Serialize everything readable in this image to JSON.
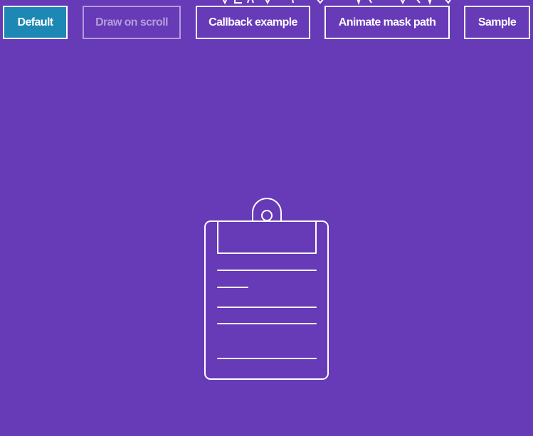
{
  "nav": {
    "buttons": [
      {
        "label": "Default",
        "state": "active"
      },
      {
        "label": "Draw on scroll",
        "state": "disabled"
      },
      {
        "label": "Callback example",
        "state": "normal"
      },
      {
        "label": "Animate mask path",
        "state": "normal"
      },
      {
        "label": "Sample",
        "state": "normal"
      }
    ]
  },
  "illustration": {
    "icon": "clipboard-icon",
    "stroke_color": "#ffffff"
  },
  "colors": {
    "background": "#673ab7",
    "active_button": "#1e88b4",
    "disabled_button": "#b39ddb",
    "button_border": "#ffffff"
  }
}
